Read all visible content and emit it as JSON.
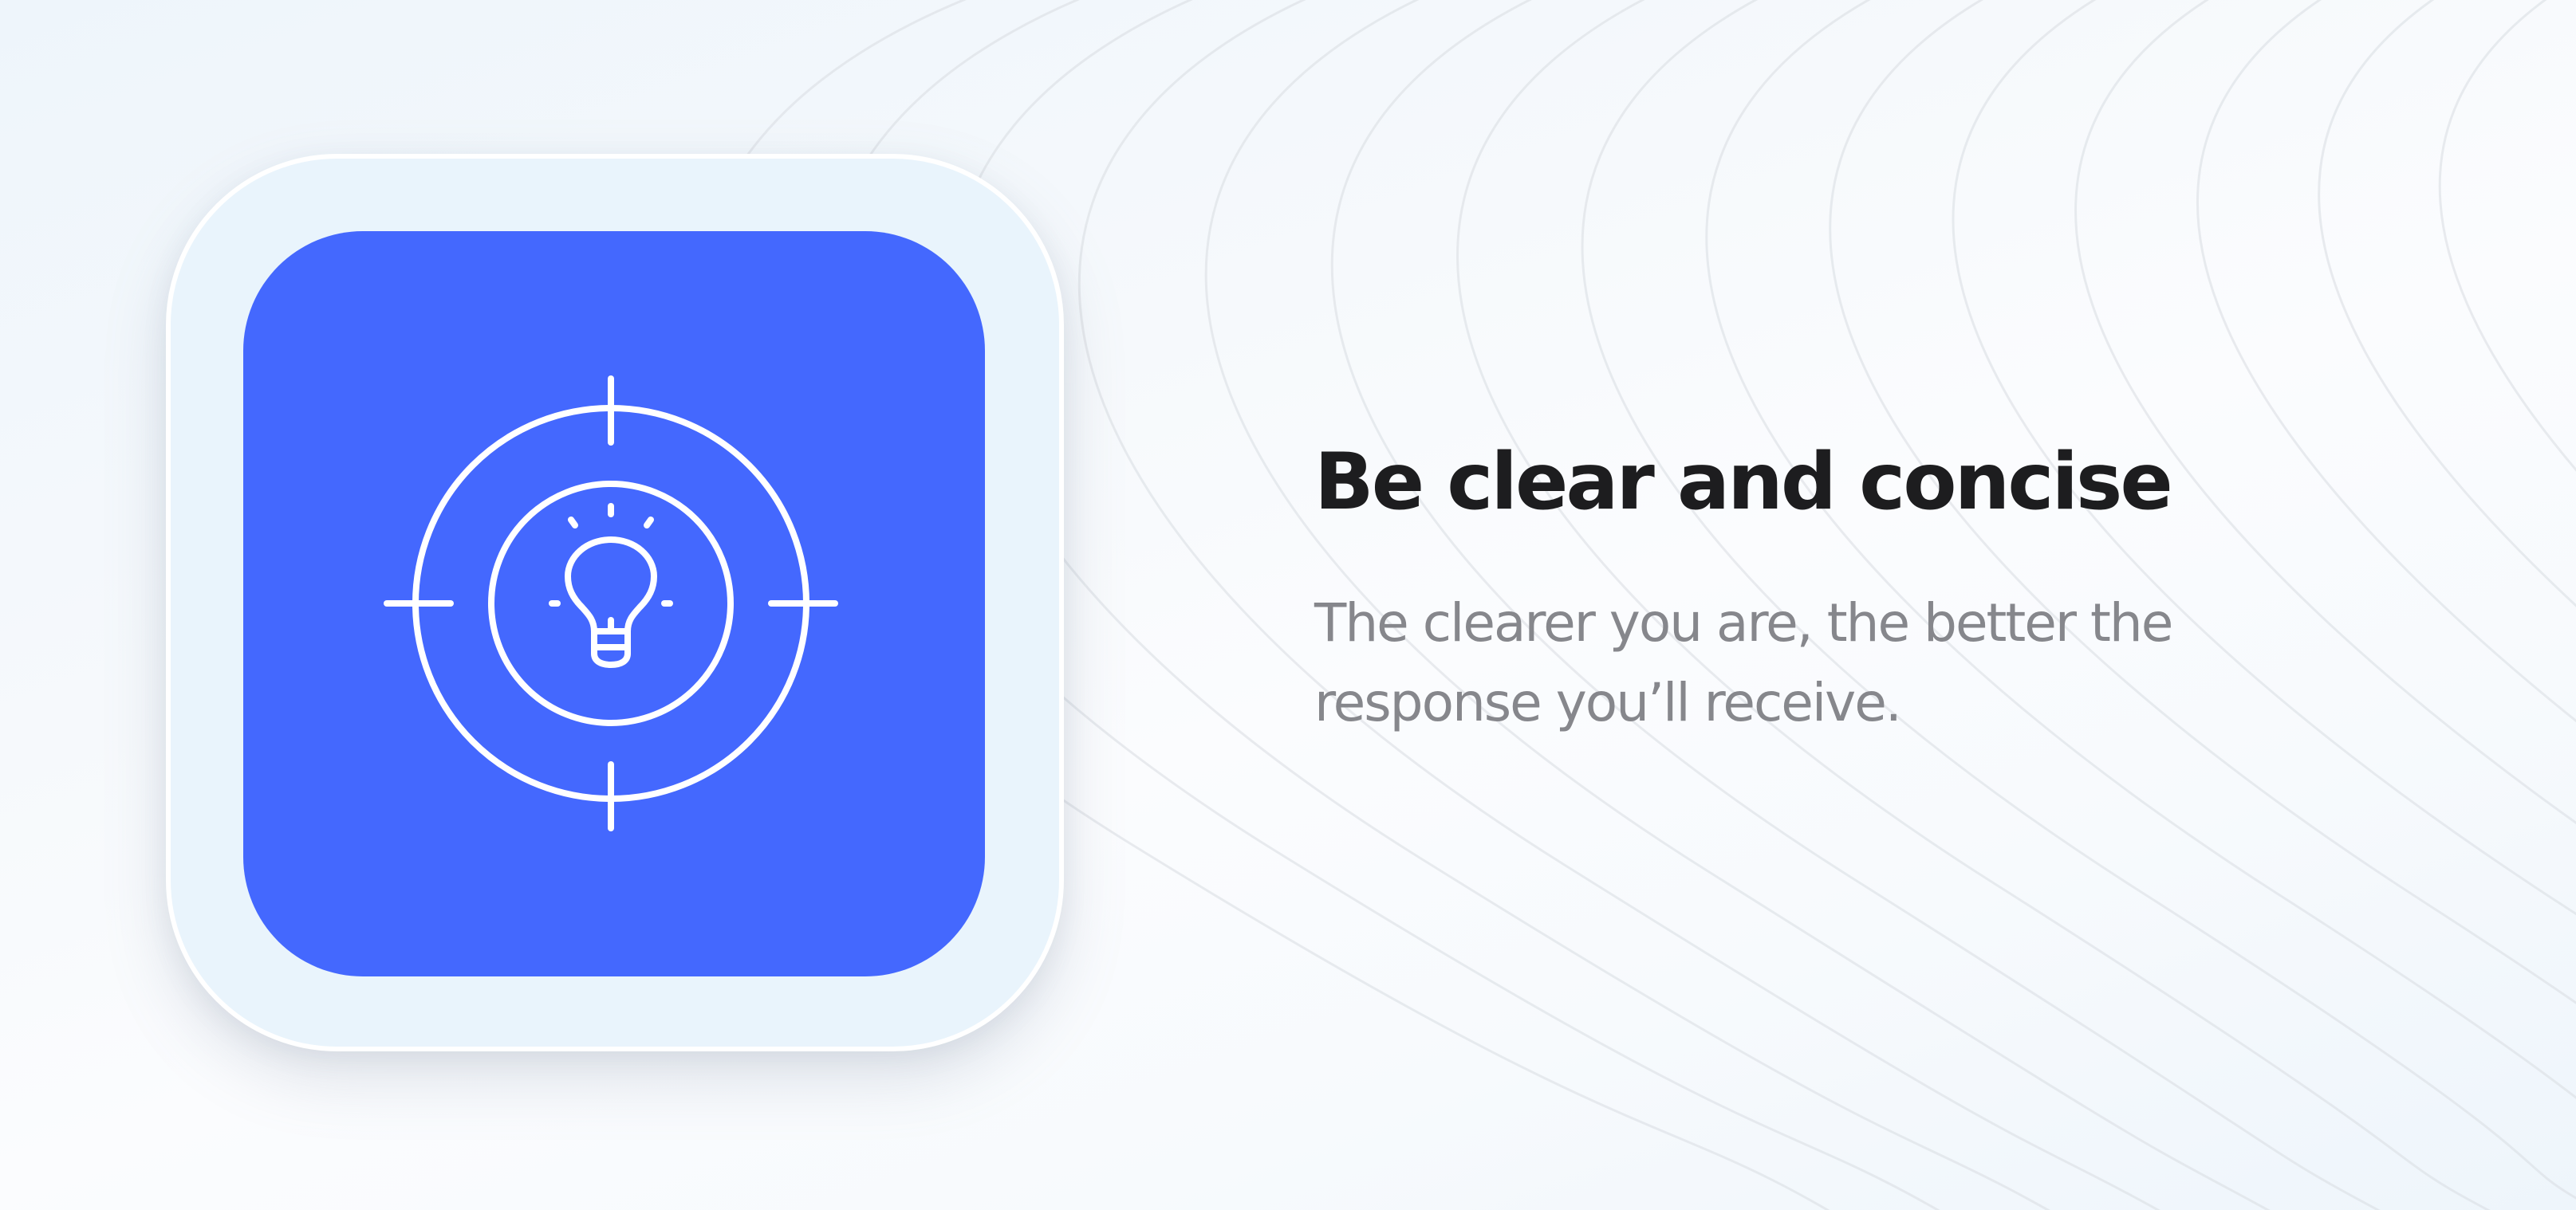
{
  "card": {
    "icon": "target-lightbulb-icon",
    "tile_color": "#4468fe",
    "frame_color": "#e9f4fc",
    "icon_color": "#ffffff"
  },
  "content": {
    "title": "Be clear and concise",
    "description": "The clearer you are, the better the response you’ll receive."
  },
  "colors": {
    "title": "#1d1d1f",
    "description": "#86878c",
    "background": "#f5f9fc"
  }
}
